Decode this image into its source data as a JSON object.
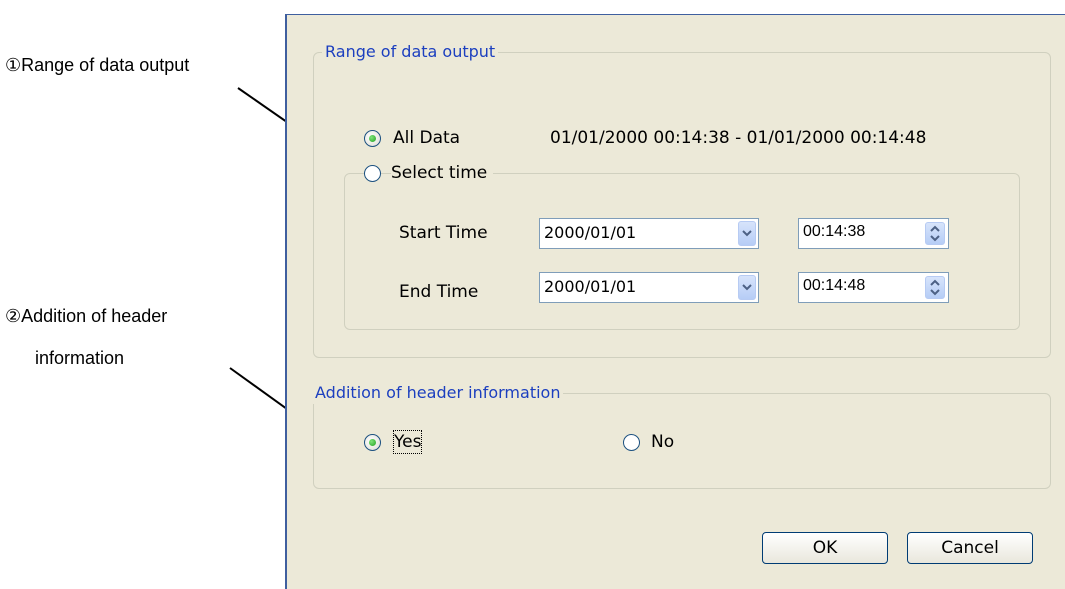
{
  "annotations": {
    "range_label": "①Range of data output",
    "header_label_line1": "②Addition of header",
    "header_label_line2": "information"
  },
  "dialog": {
    "range_group": {
      "legend": "Range of data output",
      "all_data_label": "All Data",
      "all_data_range": "01/01/2000 00:14:38 - 01/01/2000 00:14:48",
      "select_time_label": "Select time",
      "all_data_selected": true,
      "select_time_selected": false
    },
    "time_group": {
      "start_label": "Start Time",
      "start_date": "2000/01/01",
      "start_time": "00:14:38",
      "end_label": "End Time",
      "end_date": "2000/01/01",
      "end_time": "00:14:48"
    },
    "header_group": {
      "legend": "Addition of header information",
      "yes_label": "Yes",
      "no_label": "No",
      "yes_selected": true,
      "no_selected": false
    },
    "buttons": {
      "ok_label": "OK",
      "cancel_label": "Cancel"
    }
  },
  "colors": {
    "dialog_bg": "#ece9d8",
    "legend_text": "#1c3fbf",
    "radio_selected": "#21a121"
  }
}
